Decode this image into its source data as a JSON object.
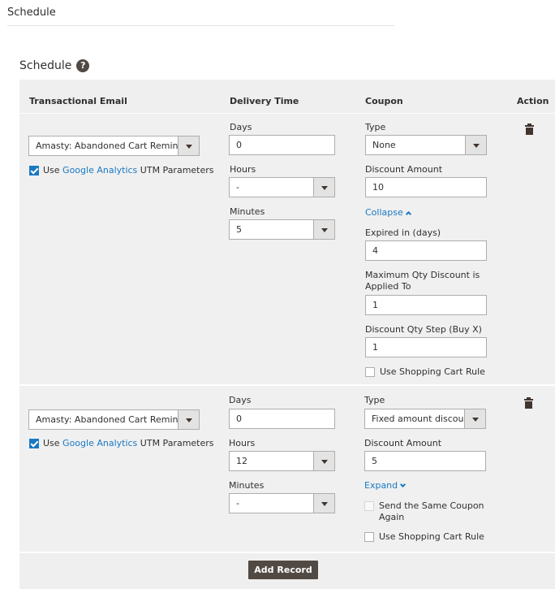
{
  "page": {
    "section_title": "Schedule",
    "block_title": "Schedule",
    "help_glyph": "?"
  },
  "grid": {
    "headers": {
      "transactional_email": "Transactional Email",
      "delivery_time": "Delivery Time",
      "coupon": "Coupon",
      "action": "Action"
    }
  },
  "records": [
    {
      "template": "Amasty: Abandoned Cart Reminder",
      "use_ga": true,
      "ga_prefix": "Use ",
      "ga_link": "Google Analytics",
      "ga_suffix": " UTM Parameters",
      "days_label": "Days",
      "days": "0",
      "hours_label": "Hours",
      "hours": "-",
      "minutes_label": "Minutes",
      "minutes": "5",
      "type_label": "Type",
      "type": "None",
      "discount_amount_label": "Discount Amount",
      "discount_amount": "10",
      "toggle_label": "Collapse",
      "expired_label": "Expired in (days)",
      "expired": "4",
      "max_qty_label_1": "Maximum Qty Discount is",
      "max_qty_label_2": "Applied To",
      "max_qty": "1",
      "qty_step_label": "Discount Qty Step (Buy X)",
      "qty_step": "1",
      "use_cart_rule_label": "Use Shopping Cart Rule",
      "use_cart_rule": false
    },
    {
      "template": "Amasty: Abandoned Cart Reminder",
      "use_ga": true,
      "ga_prefix": "Use ",
      "ga_link": "Google Analytics",
      "ga_suffix": " UTM Parameters",
      "days_label": "Days",
      "days": "0",
      "hours_label": "Hours",
      "hours": "12",
      "minutes_label": "Minutes",
      "minutes": "-",
      "type_label": "Type",
      "type": "Fixed amount discount",
      "discount_amount_label": "Discount Amount",
      "discount_amount": "5",
      "toggle_label": "Expand",
      "same_coupon_label_1": "Send the Same Coupon",
      "same_coupon_label_2": "Again",
      "same_coupon": false,
      "use_cart_rule_label": "Use Shopping Cart Rule",
      "use_cart_rule": false
    }
  ],
  "actions": {
    "add_record": "Add Record"
  },
  "icons": {
    "help": "help-icon",
    "delete": "trash-icon",
    "collapse": "chevron-up-icon",
    "expand": "chevron-down-icon",
    "dropdown": "chevron-down-icon"
  },
  "colors": {
    "link": "#1979c3",
    "button": "#514943",
    "grid_bg": "#f0f0f0"
  }
}
